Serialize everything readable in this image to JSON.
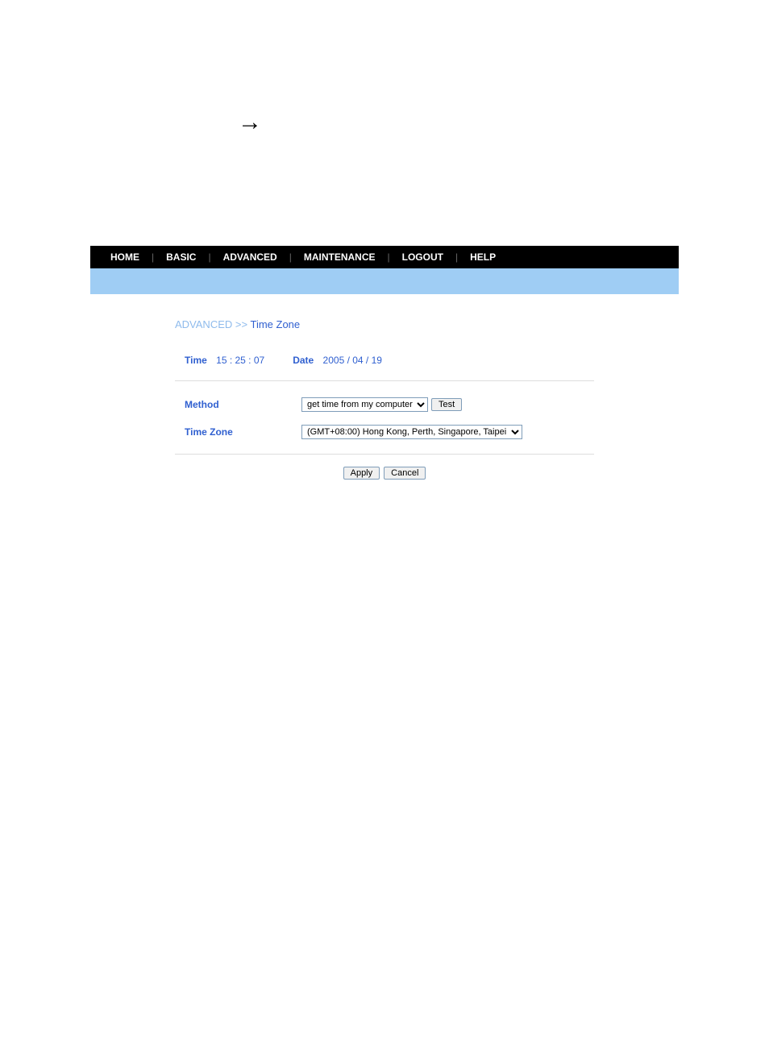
{
  "arrow_glyph": "→",
  "nav": {
    "items": [
      "HOME",
      "BASIC",
      "ADVANCED",
      "MAINTENANCE",
      "LOGOUT",
      "HELP"
    ],
    "separator": "|"
  },
  "breadcrumb": {
    "section": "ADVANCED",
    "sep": ">>",
    "page": "Time Zone"
  },
  "timeRow": {
    "timeLabel": "Time",
    "timeValue": "15   :  25   :  07",
    "dateLabel": "Date",
    "dateValue": "2005   /  04   /  19"
  },
  "form": {
    "method": {
      "label": "Method",
      "selected": "get time from my computer",
      "testButton": "Test"
    },
    "timeZone": {
      "label": "Time Zone",
      "selected": "(GMT+08:00) Hong Kong, Perth, Singapore, Taipei"
    }
  },
  "buttons": {
    "apply": "Apply",
    "cancel": "Cancel"
  }
}
